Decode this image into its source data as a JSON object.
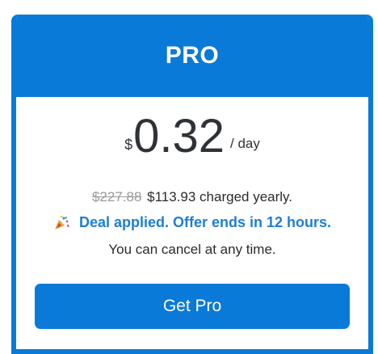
{
  "plan": {
    "name": "PRO",
    "currency_symbol": "$",
    "price_per_day": "0.32",
    "period": "/ day",
    "original_yearly_price": "$227.88",
    "yearly_price_text": "$113.93 charged yearly.",
    "deal_text": "Deal applied. Offer ends in 12 hours.",
    "cancel_text": "You can cancel at any time.",
    "cta_label": "Get Pro"
  },
  "icons": {
    "deal": "party-popper-icon"
  },
  "colors": {
    "accent": "#0a7ad8",
    "deal_text": "#1e7fd2",
    "strikethrough": "#9a9a9a"
  }
}
